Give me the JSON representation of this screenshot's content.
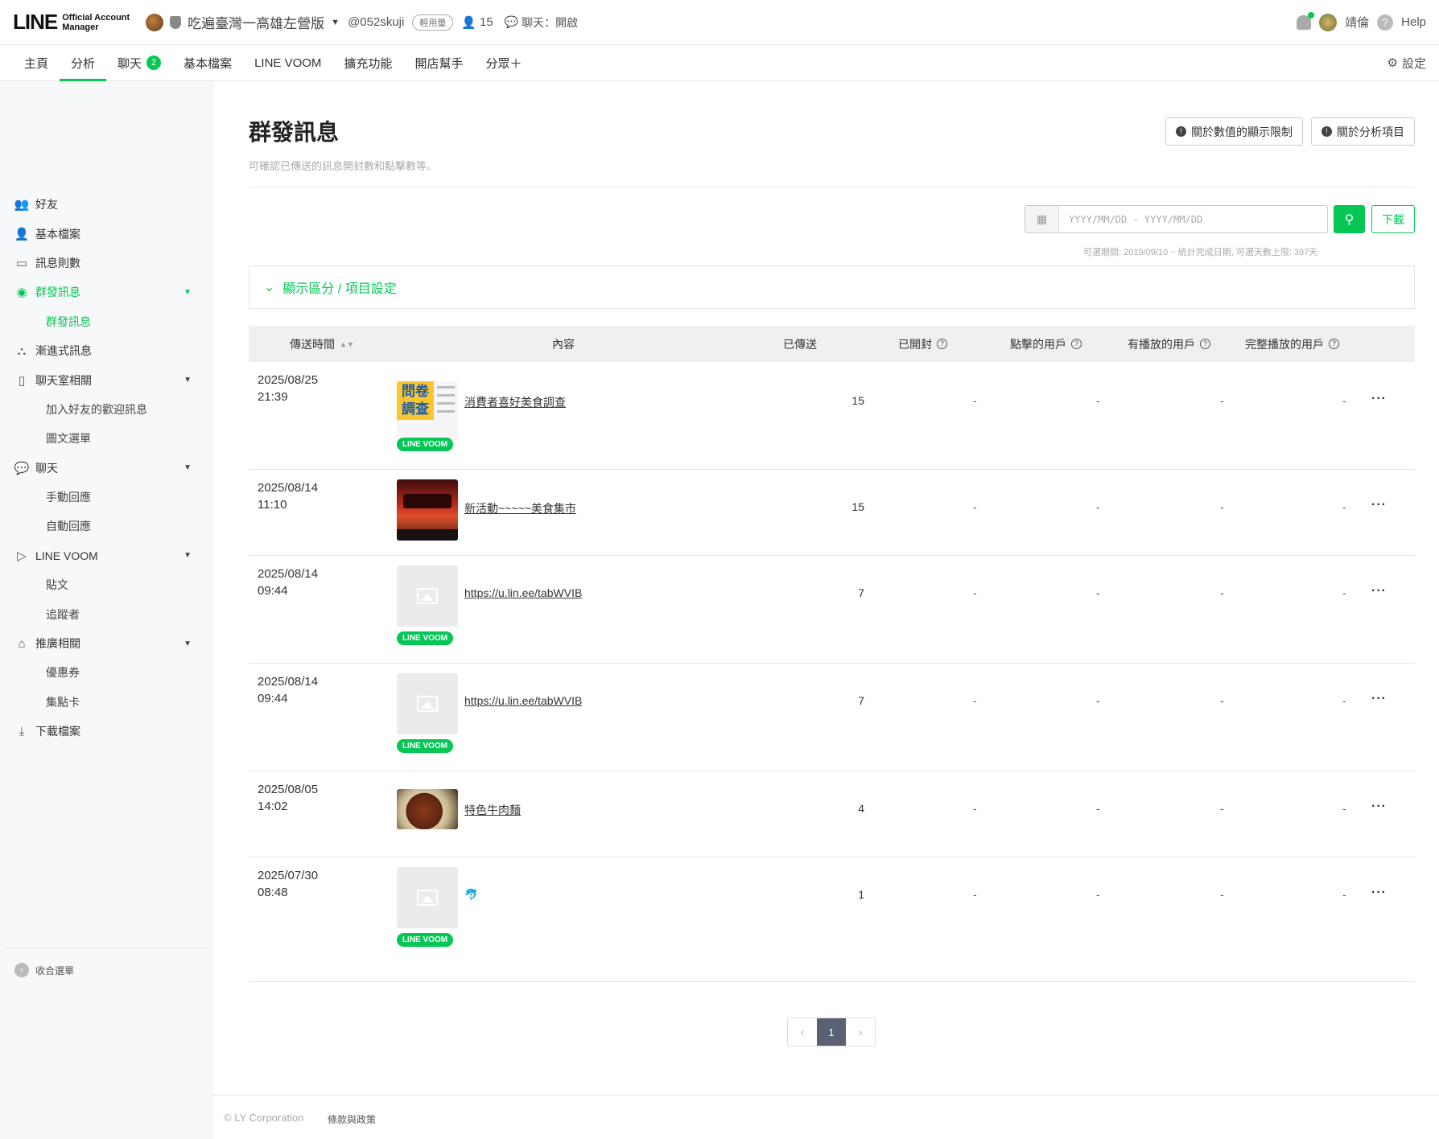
{
  "header": {
    "logo_main": "LINE",
    "logo_sub_1": "Official Account",
    "logo_sub_2": "Manager",
    "account_name": "吃遍臺灣一高雄左營版",
    "account_id": "@052skuji",
    "plan_badge": "輕用量",
    "friends_count": "15",
    "chat_status": "聊天：開啟",
    "user_name": "靖倫",
    "help_label": "Help"
  },
  "nav": {
    "items": [
      "主頁",
      "分析",
      "聊天",
      "基本檔案",
      "LINE VOOM",
      "擴充功能",
      "開店幫手",
      "分眾＋"
    ],
    "chat_badge": "2",
    "settings_label": "設定"
  },
  "sidebar": {
    "items": [
      {
        "label": "好友",
        "icon": "friends-icon"
      },
      {
        "label": "基本檔案",
        "icon": "profile-icon"
      },
      {
        "label": "訊息則數",
        "icon": "inbox-icon"
      },
      {
        "label": "群發訊息",
        "icon": "broadcast-icon"
      },
      {
        "label": "群發訊息",
        "icon": ""
      },
      {
        "label": "漸進式訊息",
        "icon": "flow-icon"
      },
      {
        "label": "聊天室相關",
        "icon": "chatroom-icon"
      },
      {
        "label": "加入好友的歡迎訊息",
        "icon": ""
      },
      {
        "label": "圖文選單",
        "icon": ""
      },
      {
        "label": "聊天",
        "icon": "chat-icon"
      },
      {
        "label": "手動回應",
        "icon": ""
      },
      {
        "label": "自動回應",
        "icon": ""
      },
      {
        "label": "LINE VOOM",
        "icon": "voom-icon"
      },
      {
        "label": "貼文",
        "icon": ""
      },
      {
        "label": "追蹤者",
        "icon": ""
      },
      {
        "label": "推廣相關",
        "icon": "shop-icon"
      },
      {
        "label": "優惠券",
        "icon": ""
      },
      {
        "label": "集點卡",
        "icon": ""
      },
      {
        "label": "下載檔案",
        "icon": "download-icon"
      }
    ],
    "collapse_label": "收合選單"
  },
  "page": {
    "title": "群發訊息",
    "description": "可確認已傳送的訊息開封數和點擊數等。",
    "info_btn_1": "關於數值的顯示限制",
    "info_btn_2": "關於分析項目",
    "date_placeholder": "YYYY/MM/DD  -  YYYY/MM/DD",
    "download_label": "下載",
    "range_note": "可選期間: 2019/09/10 ~ 統計完成日期, 可選天數上限: 397天",
    "panel_label": "顯示區分 / 項目設定"
  },
  "table": {
    "headers": [
      "傳送時間",
      "內容",
      "已傳送",
      "已開封",
      "點擊的用戶",
      "有播放的用戶",
      "完整播放的用戶"
    ],
    "voom_badge": "LINE VOOM",
    "rows": [
      {
        "date": "2025/08/25",
        "time": "21:39",
        "title": "消費者喜好美食調查",
        "sent": "15",
        "opened": "-",
        "clicked": "-",
        "played": "-",
        "full_played": "-"
      },
      {
        "date": "2025/08/14",
        "time": "11:10",
        "title": "新活動~~~~~美食集市",
        "sent": "15",
        "opened": "-",
        "clicked": "-",
        "played": "-",
        "full_played": "-"
      },
      {
        "date": "2025/08/14",
        "time": "09:44",
        "title": "https://u.lin.ee/tabWVIB",
        "sent": "7",
        "opened": "-",
        "clicked": "-",
        "played": "-",
        "full_played": "-"
      },
      {
        "date": "2025/08/14",
        "time": "09:44",
        "title": "https://u.lin.ee/tabWVIB",
        "sent": "7",
        "opened": "-",
        "clicked": "-",
        "played": "-",
        "full_played": "-"
      },
      {
        "date": "2025/08/05",
        "time": "14:02",
        "title": "特色牛肉麵",
        "sent": "4",
        "opened": "-",
        "clicked": "-",
        "played": "-",
        "full_played": "-"
      },
      {
        "date": "2025/07/30",
        "time": "08:48",
        "title": "🐬",
        "sent": "1",
        "opened": "-",
        "clicked": "-",
        "played": "-",
        "full_played": "-"
      }
    ],
    "survey_thumb_text": "問卷調查"
  },
  "pager": {
    "current": "1",
    "prev": "‹",
    "next": "›"
  },
  "footer": {
    "copyright": "© LY Corporation",
    "terms": "條款與政策"
  },
  "colors": {
    "accent": "#06c755",
    "table_head_bg": "#eef0f2"
  }
}
